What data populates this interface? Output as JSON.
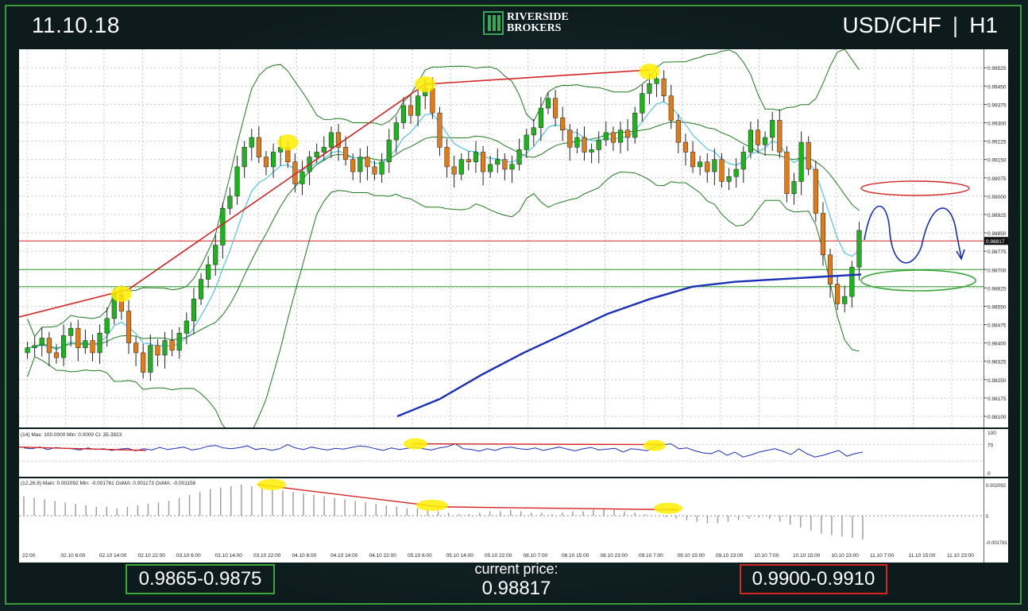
{
  "header": {
    "date": "11.10.18",
    "pair": "USD/CHF",
    "timeframe": "H1",
    "separator": "|",
    "logo_line1": "RIVERSIDE",
    "logo_line2": "BROKERS"
  },
  "footer": {
    "support_zone": "0.9865-0.9875",
    "current_price_label": "current price:",
    "current_price": "0.98817",
    "resistance_zone": "0.9900-0.9910"
  },
  "colors": {
    "bull_candle": "#1db31d",
    "bear_candle": "#e07b1a",
    "bollinger": "#1e7a1e",
    "ema_fast": "#4fc6e6",
    "ma_slow": "#1a2fb8",
    "trendline": "#d42424",
    "highlight": "#ffef00",
    "support_line": "#2f9a2f",
    "resistance_line": "#d42424",
    "forecast_path": "#1a2fb8",
    "support_box": "#3ba83b",
    "resistance_box": "#d42424"
  },
  "chart_data": [
    {
      "panel": "price",
      "type": "candlestick",
      "ylim": [
        0.981,
        0.99555
      ],
      "y_ticks": [
        "0.99525",
        "0.99450",
        "0.99375",
        "0.99300",
        "0.99225",
        "0.99150",
        "0.99075",
        "0.99000",
        "0.98925",
        "0.98850",
        "0.98775",
        "0.98700",
        "0.98625",
        "0.98550",
        "0.98475",
        "0.98400",
        "0.98325",
        "0.98250",
        "0.98175",
        "0.98100"
      ],
      "price_label": "0.98817",
      "x_ticks": [
        "22:00",
        "02.10 6:00",
        "02.10 14:00",
        "02.10 22:00",
        "03.10 6:00",
        "03.10 14:00",
        "03.10 22:00",
        "04.10 6:00",
        "04.10 14:00",
        "04.10 22:00",
        "05.10 6:00",
        "05.10 14:00",
        "05.10 22:00",
        "08.10 7:00",
        "08.10 15:00",
        "08.10 23:00",
        "09.10 7:00",
        "09.10 15:00",
        "09.10 23:00",
        "10.10 7:00",
        "10.10 15:00",
        "10.10 23:00",
        "11.10 7:00",
        "11.10 15:00",
        "11.10 23:00",
        "12.10 7:00"
      ],
      "closes": [
        0.9838,
        0.9839,
        0.9842,
        0.9836,
        0.9834,
        0.9843,
        0.9846,
        0.9838,
        0.9841,
        0.9836,
        0.9844,
        0.985,
        0.986,
        0.9853,
        0.984,
        0.9836,
        0.9828,
        0.9839,
        0.9835,
        0.9841,
        0.9837,
        0.9844,
        0.9849,
        0.9858,
        0.9866,
        0.9872,
        0.988,
        0.9895,
        0.99,
        0.9912,
        0.992,
        0.9924,
        0.9916,
        0.9912,
        0.9918,
        0.992,
        0.9914,
        0.9905,
        0.991,
        0.9916,
        0.9918,
        0.992,
        0.9926,
        0.992,
        0.9915,
        0.991,
        0.9916,
        0.9912,
        0.9909,
        0.9914,
        0.9923,
        0.993,
        0.9937,
        0.9933,
        0.9941,
        0.9944,
        0.9934,
        0.992,
        0.9912,
        0.9909,
        0.9915,
        0.9914,
        0.9918,
        0.991,
        0.9913,
        0.9915,
        0.9911,
        0.9913,
        0.9919,
        0.9925,
        0.9928,
        0.9936,
        0.994,
        0.9932,
        0.9927,
        0.992,
        0.9924,
        0.9918,
        0.9919,
        0.9923,
        0.9926,
        0.9922,
        0.9927,
        0.9924,
        0.9934,
        0.9942,
        0.9946,
        0.9948,
        0.9941,
        0.9931,
        0.9922,
        0.9918,
        0.9912,
        0.9914,
        0.991,
        0.9915,
        0.9906,
        0.9908,
        0.9911,
        0.9918,
        0.9927,
        0.9921,
        0.9924,
        0.9931,
        0.9918,
        0.9901,
        0.9906,
        0.9922,
        0.9911,
        0.9893,
        0.9876,
        0.9864,
        0.9856,
        0.9859,
        0.9871,
        0.9886
      ],
      "ma200_values": [
        0.981,
        0.9817,
        0.9827,
        0.9836,
        0.9844,
        0.9852,
        0.9858,
        0.9863,
        0.9865,
        0.9866,
        0.9867,
        0.9868
      ],
      "bollinger_note": "Bollinger Bands with center line",
      "support_levels": [
        0.987,
        0.9863
      ],
      "resistance_level": 0.98817,
      "trendlines": [
        {
          "from": [
            0.9853
          ],
          "to": [
            0.9948
          ]
        }
      ],
      "highlights": [
        "trend-low",
        "peak-1",
        "peak-2",
        "peak-3"
      ]
    },
    {
      "panel": "rsi",
      "type": "line",
      "label": "(14) Max: 100.0000  Min: 0.0000  Ci: 35.3923",
      "y_ticks": [
        "100",
        "70",
        "0"
      ],
      "values": [
        62,
        60,
        64,
        58,
        63,
        61,
        60,
        57,
        62,
        58,
        60,
        56,
        59,
        61,
        55,
        60,
        57,
        63,
        58,
        61,
        64,
        57,
        60,
        66,
        68,
        62,
        60,
        63,
        67,
        58,
        61,
        56,
        60,
        70,
        62,
        58,
        64,
        60,
        57,
        61,
        59,
        63,
        67,
        65,
        60,
        56,
        62,
        58,
        61,
        64,
        60,
        57,
        62,
        65,
        72,
        60,
        58,
        54,
        60,
        56,
        62,
        64,
        60,
        58,
        62,
        56,
        60,
        64,
        59,
        55,
        60,
        63,
        57,
        59,
        61,
        52,
        60,
        58,
        55,
        64,
        70,
        72,
        60,
        62,
        55,
        50,
        48,
        56,
        44,
        52,
        40,
        45,
        52,
        56,
        60,
        54,
        46,
        60,
        48,
        40,
        44,
        50,
        56,
        42,
        48,
        52
      ]
    },
    {
      "panel": "macd",
      "type": "bar",
      "label": "(12,26,9)  Main: 0.002092  Min: -0.001761  OsMA: 0.001173  OsMA: -0.001156",
      "y_ticks": [
        "0.002092",
        "0",
        "-0.001761"
      ],
      "values": [
        0.0013,
        0.0012,
        0.0011,
        0.001,
        0.0009,
        0.0008,
        0.0007,
        0.0006,
        0.0006,
        0.0005,
        0.0006,
        0.0007,
        0.0008,
        0.0009,
        0.001,
        0.0012,
        0.0014,
        0.0016,
        0.0018,
        0.0019,
        0.002,
        0.0021,
        0.002,
        0.0019,
        0.0018,
        0.0017,
        0.0016,
        0.0015,
        0.0014,
        0.0013,
        0.0012,
        0.0011,
        0.001,
        0.0009,
        0.0008,
        0.0007,
        0.0006,
        0.0005,
        0.0005,
        0.0004,
        0.0003,
        0.0002,
        0.0001,
        0.0001,
        0.0002,
        0.0003,
        0.0003,
        0.0004,
        0.0003,
        0.0002,
        0.0002,
        0.0001,
        0.0002,
        0.0003,
        0.0003,
        0.0004,
        0.0005,
        0.0004,
        0.0003,
        0.0002,
        0.0001,
        0.0,
        -0.0001,
        -0.0002,
        -0.0003,
        -0.0004,
        -0.0005,
        -0.0005,
        -0.0004,
        -0.0003,
        -0.0002,
        -0.0001,
        -0.0002,
        -0.0004,
        -0.0006,
        -0.0008,
        -0.001,
        -0.0012,
        -0.0013,
        -0.0014,
        -0.0015,
        -0.0016
      ]
    }
  ]
}
